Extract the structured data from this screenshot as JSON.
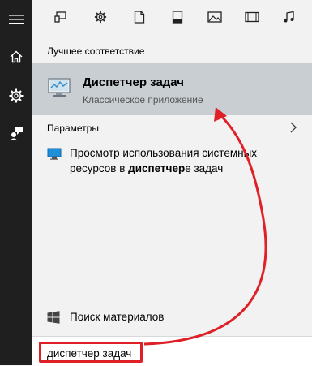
{
  "sidebar": {
    "items": [
      {
        "icon": "hamburger-icon"
      },
      {
        "icon": "home-icon"
      },
      {
        "icon": "gear-icon"
      },
      {
        "icon": "feedback-icon"
      }
    ]
  },
  "filters": [
    {
      "icon": "apps-filter-icon"
    },
    {
      "icon": "settings-filter-icon"
    },
    {
      "icon": "documents-filter-icon"
    },
    {
      "icon": "folders-filter-icon"
    },
    {
      "icon": "photos-filter-icon"
    },
    {
      "icon": "videos-filter-icon"
    },
    {
      "icon": "music-filter-icon"
    }
  ],
  "best_match": {
    "heading": "Лучшее соответствие",
    "title": "Диспетчер задач",
    "subtitle": "Классическое приложение",
    "icon": "task-manager-icon"
  },
  "settings": {
    "heading": "Параметры",
    "item_prefix": "Просмотр использования системных ресурсов в ",
    "item_highlight": "диспетчер",
    "item_suffix": "е задач",
    "icon": "monitor-icon"
  },
  "search_materials": {
    "label": "Поиск материалов",
    "icon": "windows-icon"
  },
  "searchbox": {
    "value": "диспетчер задач"
  },
  "colors": {
    "sidebar": "#1f1f1f",
    "panel": "#f2f2f2",
    "selected": "#c9ced3",
    "annotation": "#e02027"
  }
}
